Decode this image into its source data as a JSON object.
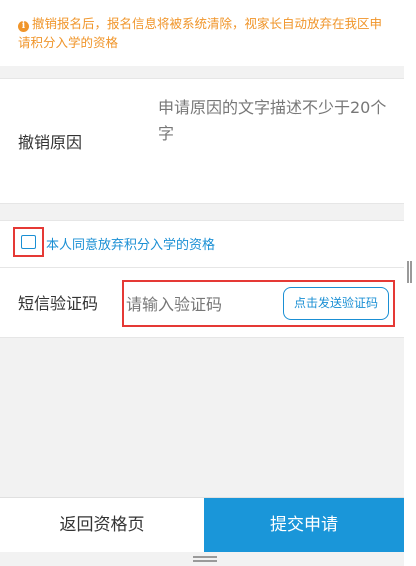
{
  "notice": {
    "icon": "info-icon",
    "text": "撤销报名后，报名信息将被系统清除，视家长自动放弃在我区申请积分入学的资格"
  },
  "reason": {
    "label": "撤销原因",
    "placeholder": "申请原因的文字描述不少于20个字"
  },
  "agreement": {
    "checked": false,
    "text": "本人同意放弃积分入学的资格"
  },
  "sms": {
    "label": "短信验证码",
    "placeholder": "请输入验证码",
    "send_label": "点击发送验证码"
  },
  "footer": {
    "back_label": "返回资格页",
    "submit_label": "提交申请"
  },
  "colors": {
    "accent": "#1a96d9",
    "warning": "#f0952a",
    "highlight": "#e53935"
  }
}
